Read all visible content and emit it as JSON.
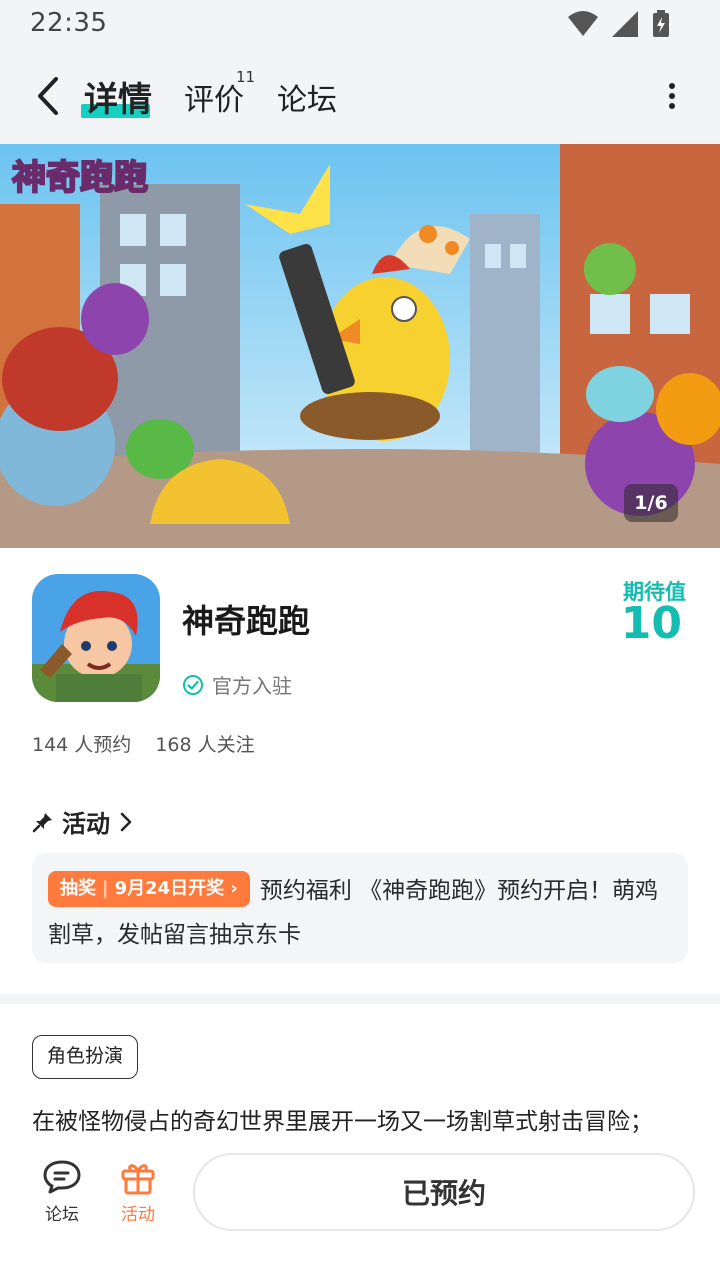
{
  "status_bar": {
    "time": "22:35"
  },
  "nav": {
    "tabs": [
      {
        "label": "详情",
        "active": true
      },
      {
        "label": "评价",
        "count": "11"
      },
      {
        "label": "论坛"
      }
    ],
    "accent_color": "#15cfc0"
  },
  "banner": {
    "logo_text": "神奇跑跑",
    "counter": "1/6"
  },
  "game": {
    "name": "神奇跑跑",
    "official_label": "官方入驻",
    "expect_label": "期待值",
    "expect_value": "10",
    "reservations": "144 人预约",
    "followers": "168 人关注"
  },
  "activity": {
    "title": "活动",
    "badge_type": "抽奖",
    "badge_date": "9月24日开奖",
    "text": "预约福利 《神奇跑跑》预约开启！萌鸡割草，发帖留言抽京东卡"
  },
  "tag": "角色扮演",
  "description": "在被怪物侵占的奇幻世界里展开一场又一场割草式射击冒险；",
  "bottom_bar": {
    "forum_label": "论坛",
    "activity_label": "活动",
    "reserve_label": "已预约"
  }
}
